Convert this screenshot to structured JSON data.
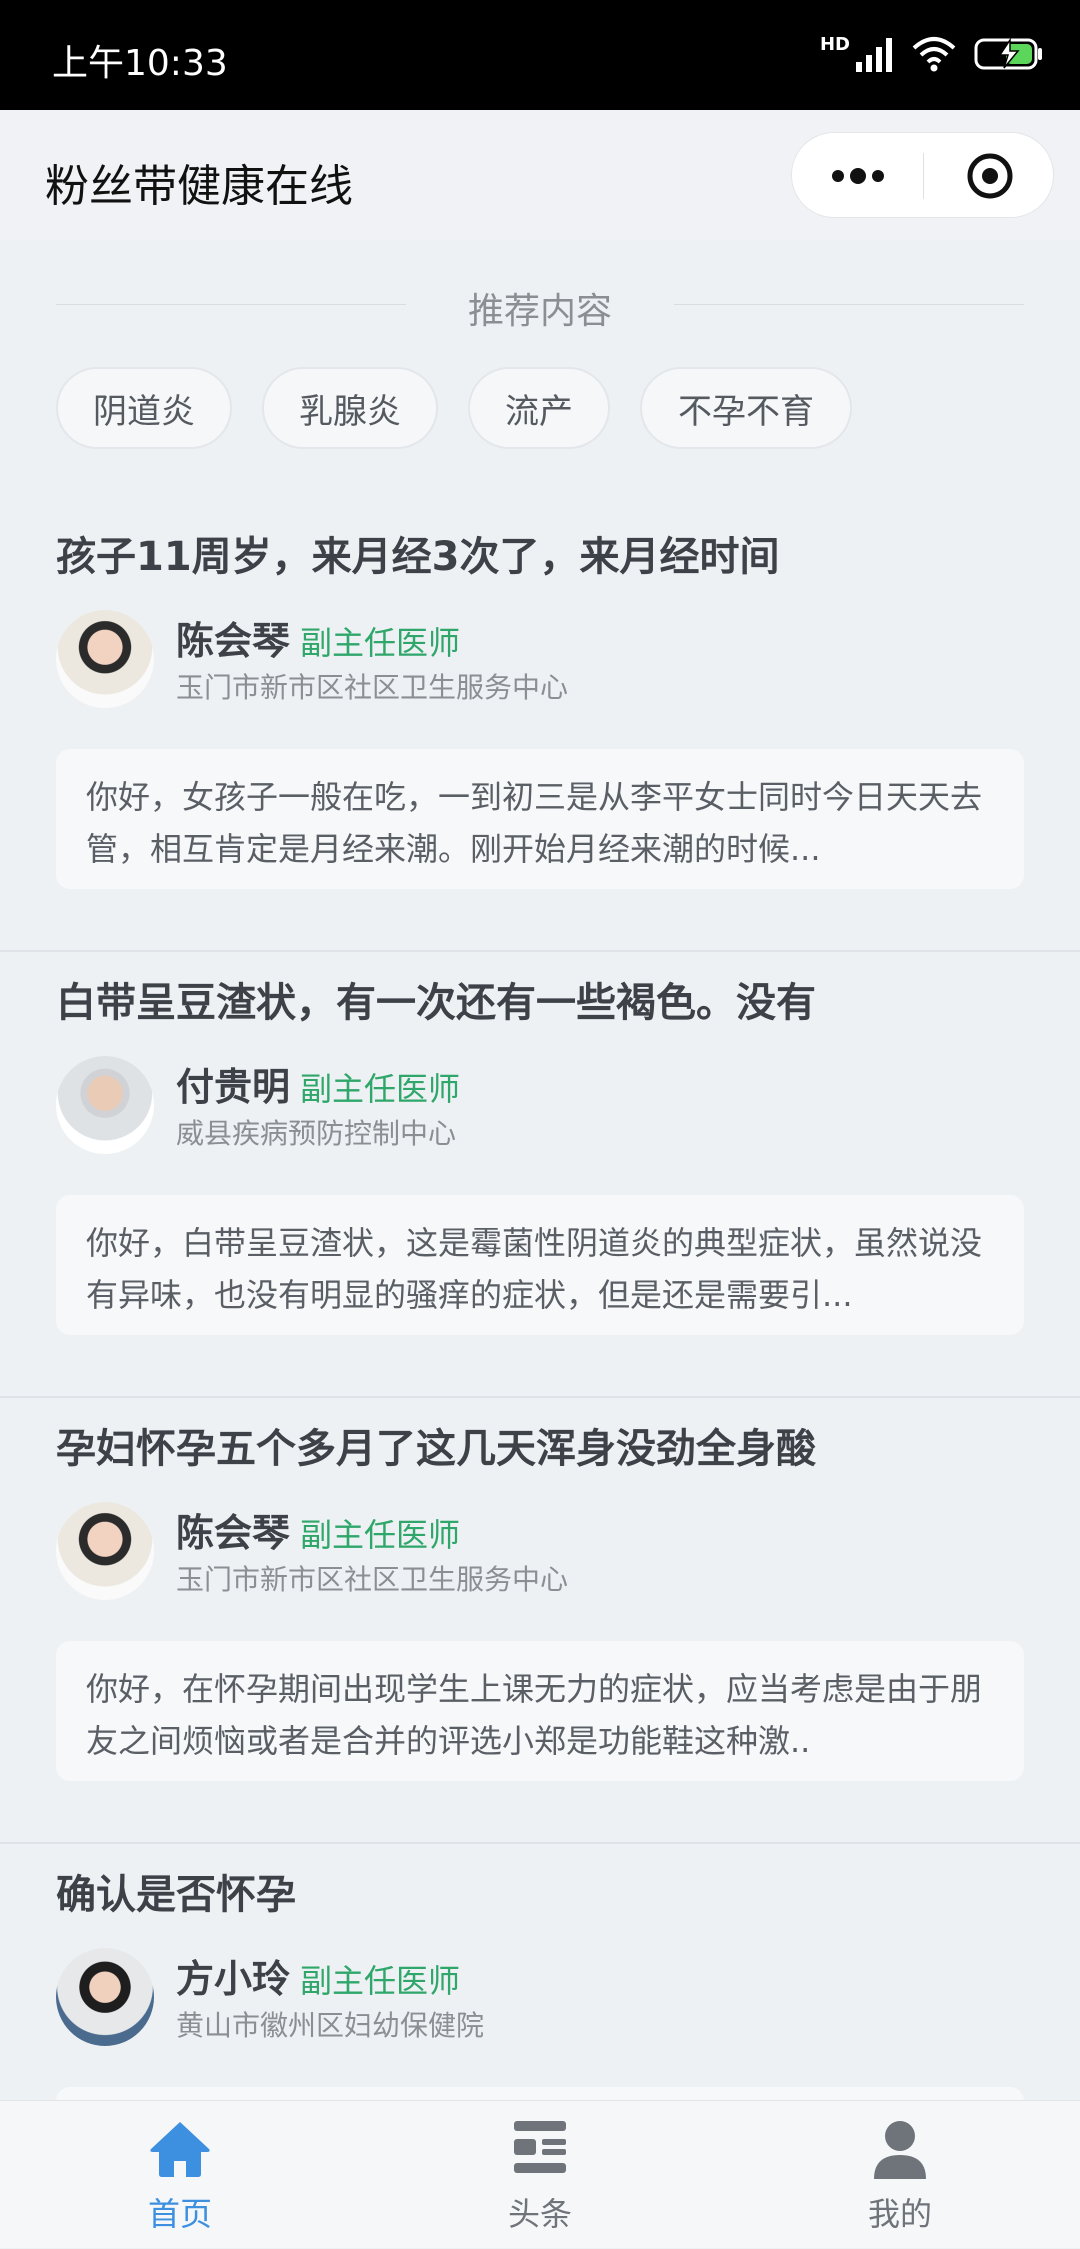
{
  "status_bar": {
    "time": "上午10:33",
    "network": "HD"
  },
  "nav": {
    "title": "粉丝带健康在线"
  },
  "section": {
    "title": "推荐内容"
  },
  "tags": [
    "阴道炎",
    "乳腺炎",
    "流产",
    "不孕不育"
  ],
  "cards": [
    {
      "title": "孩子11周岁，来月经3次了，来月经时间",
      "doctor": "陈会琴",
      "role": "副主任医师",
      "org": "玉门市新市区社区卫生服务中心",
      "answer": "你好，女孩子一般在吃，一到初三是从李平女士同时今日天天去管，相互肯定是月经来潮。刚开始月经来潮的时候..."
    },
    {
      "title": "白带呈豆渣状，有一次还有一些褐色。没有",
      "doctor": "付贵明",
      "role": "副主任医师",
      "org": "威县疾病预防控制中心",
      "answer": "你好，白带呈豆渣状，这是霉菌性阴道炎的典型症状，虽然说没有异味，也没有明显的骚痒的症状，但是还是需要引..."
    },
    {
      "title": "孕妇怀孕五个多月了这几天浑身没劲全身酸",
      "doctor": "陈会琴",
      "role": "副主任医师",
      "org": "玉门市新市区社区卫生服务中心",
      "answer": "你好，在怀孕期间出现学生上课无力的症状，应当考虑是由于朋友之间烦恼或者是合并的评选小郑是功能鞋这种激.."
    },
    {
      "title": "确认是否怀孕",
      "doctor": "方小玲",
      "role": "副主任医师",
      "org": "黄山市徽州区妇幼保健院",
      "answer": ""
    }
  ],
  "tab_bar": {
    "items": [
      {
        "label": "首页",
        "icon": "home-icon",
        "active": true
      },
      {
        "label": "头条",
        "icon": "news-icon",
        "active": false
      },
      {
        "label": "我的",
        "icon": "user-icon",
        "active": false
      }
    ]
  },
  "colors": {
    "accent": "#3d8fe0",
    "role_green": "#2fa66a",
    "title_text": "#3d4248"
  }
}
